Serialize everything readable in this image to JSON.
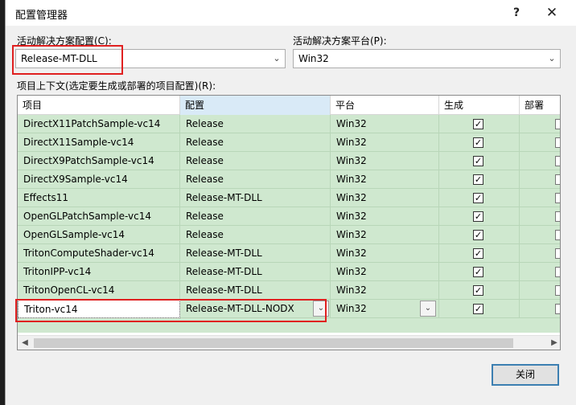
{
  "dialog": {
    "title": "配置管理器",
    "help_glyph": "?",
    "close_glyph": "✕"
  },
  "solution_config": {
    "label": "活动解决方案配置(C):",
    "value": "Release-MT-DLL"
  },
  "solution_platform": {
    "label": "活动解决方案平台(P):",
    "value": "Win32"
  },
  "project_contexts_label": "项目上下文(选定要生成或部署的项目配置)(R):",
  "grid": {
    "columns": [
      "项目",
      "配置",
      "平台",
      "生成",
      "部署"
    ],
    "rows": [
      {
        "project": "DirectX11PatchSample-vc14",
        "config": "Release",
        "platform": "Win32",
        "build": true
      },
      {
        "project": "DirectX11Sample-vc14",
        "config": "Release",
        "platform": "Win32",
        "build": true
      },
      {
        "project": "DirectX9PatchSample-vc14",
        "config": "Release",
        "platform": "Win32",
        "build": true
      },
      {
        "project": "DirectX9Sample-vc14",
        "config": "Release",
        "platform": "Win32",
        "build": true
      },
      {
        "project": "Effects11",
        "config": "Release-MT-DLL",
        "platform": "Win32",
        "build": true
      },
      {
        "project": "OpenGLPatchSample-vc14",
        "config": "Release",
        "platform": "Win32",
        "build": true
      },
      {
        "project": "OpenGLSample-vc14",
        "config": "Release",
        "platform": "Win32",
        "build": true
      },
      {
        "project": "TritonComputeShader-vc14",
        "config": "Release-MT-DLL",
        "platform": "Win32",
        "build": true
      },
      {
        "project": "TritonIPP-vc14",
        "config": "Release-MT-DLL",
        "platform": "Win32",
        "build": true
      },
      {
        "project": "TritonOpenCL-vc14",
        "config": "Release-MT-DLL",
        "platform": "Win32",
        "build": true
      },
      {
        "project": "Triton-vc14",
        "config": "Release-MT-DLL-NODX",
        "platform": "Win32",
        "build": true,
        "selected": true
      }
    ]
  },
  "buttons": {
    "close_label": "关闭"
  },
  "colors": {
    "row_bg": "#cfe8cf",
    "highlight": "#e02020",
    "active_header": "#d9eaf7"
  }
}
